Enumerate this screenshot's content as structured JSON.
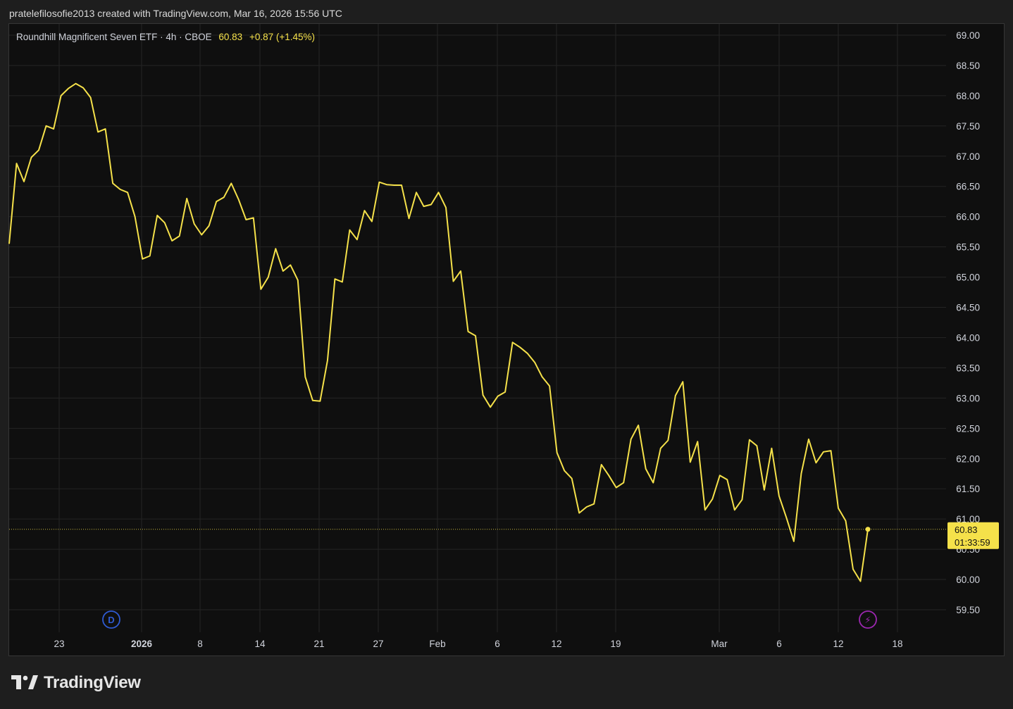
{
  "header": {
    "caption": "pratelefilosofie2013 created with TradingView.com, Mar 16, 2026 15:56 UTC"
  },
  "legend": {
    "symbol": "Roundhill Magnificent Seven ETF · 4h · CBOE",
    "last": "60.83",
    "change": "+0.87 (+1.45%)"
  },
  "price_label": {
    "price": "60.83",
    "countdown": "01:33:59"
  },
  "event_markers": [
    {
      "glyph": "D",
      "icon": "dividend-icon",
      "color": "#2f5bd3"
    },
    {
      "glyph": "⚡",
      "icon": "earnings-flash-icon",
      "color": "#9c27b0"
    }
  ],
  "footer": {
    "brand": "TradingView"
  },
  "colors": {
    "line": "#f5e14a",
    "background": "#0f0f0f",
    "grid": "#242424",
    "text": "#d1d4dc"
  },
  "chart_data": {
    "type": "line",
    "title": "Roundhill Magnificent Seven ETF · 4h · CBOE",
    "xlabel": "",
    "ylabel": "",
    "ylim": [
      59.1,
      69.2
    ],
    "grid": true,
    "y_ticks": [
      "69.00",
      "68.50",
      "68.00",
      "67.50",
      "67.00",
      "66.50",
      "66.00",
      "65.50",
      "65.00",
      "64.50",
      "64.00",
      "63.50",
      "63.00",
      "62.50",
      "62.00",
      "61.50",
      "61.00",
      "60.50",
      "60.00",
      "59.50"
    ],
    "x_ticks": [
      "23",
      "2026",
      "8",
      "14",
      "21",
      "27",
      "Feb",
      "6",
      "12",
      "19",
      "Mar",
      "6",
      "12",
      "18"
    ],
    "series": [
      {
        "values": [
          65.55,
          66.88,
          66.58,
          66.98,
          67.1,
          67.5,
          67.45,
          68.0,
          68.12,
          68.2,
          68.13,
          67.97,
          67.4,
          67.45,
          66.55,
          66.45,
          66.4,
          66.0,
          65.3,
          65.35,
          66.02,
          65.9,
          65.6,
          65.68,
          66.3,
          65.88,
          65.7,
          65.85,
          66.25,
          66.32,
          66.55,
          66.28,
          65.95,
          65.98,
          64.8,
          65.0,
          65.47,
          65.1,
          65.2,
          64.95,
          63.35,
          62.96,
          62.95,
          63.62,
          64.97,
          64.92,
          65.78,
          65.62,
          66.1,
          65.92,
          66.57,
          66.53,
          66.52,
          66.52,
          65.97,
          66.4,
          66.17,
          66.2,
          66.4,
          66.15,
          64.93,
          65.1,
          64.1,
          64.03,
          63.05,
          62.85,
          63.03,
          63.1,
          63.92,
          63.84,
          63.74,
          63.59,
          63.35,
          63.2,
          62.1,
          61.8,
          61.67,
          61.1,
          61.2,
          61.25,
          61.9,
          61.72,
          61.52,
          61.6,
          62.32,
          62.55,
          61.83,
          61.6,
          62.17,
          62.3,
          63.04,
          63.27,
          61.94,
          62.28,
          61.15,
          61.33,
          61.72,
          61.65,
          61.15,
          61.32,
          62.31,
          62.21,
          61.48,
          62.17,
          61.38,
          61.02,
          60.63,
          61.75,
          62.32,
          61.93,
          62.11,
          62.13,
          61.18,
          60.97,
          60.17,
          59.97,
          60.83
        ]
      }
    ]
  }
}
